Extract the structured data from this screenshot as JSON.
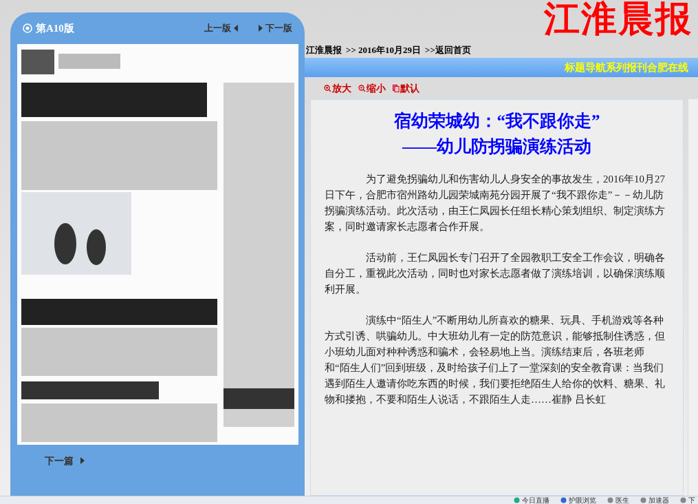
{
  "edition_panel": {
    "edition": "第A10版",
    "prev_label": "上一版",
    "next_label": "下一版",
    "next_article": "下一篇"
  },
  "header": {
    "logo": "江淮晨报",
    "breadcrumb": [
      {
        "text": "江淮晨报"
      },
      {
        "text": ">> 2016年10月29日"
      },
      {
        "text": ">>返回首页"
      }
    ],
    "nav_links": [
      "标题导航",
      "系列报刊",
      "合肥在线"
    ]
  },
  "zoom_controls": [
    {
      "kind": "zoom-in",
      "label": "放大"
    },
    {
      "kind": "zoom-out",
      "label": "缩小"
    },
    {
      "kind": "reset",
      "label": "默认"
    }
  ],
  "article": {
    "title_lines": [
      "宿幼荣城幼：“我不跟你走”",
      "——幼儿防拐骗演练活动"
    ],
    "paragraphs": [
      "为了避免拐骗幼儿和伤害幼儿人身安全的事故发生，2016年10月27日下午，合肥市宿州路幼儿园荣城南苑分园开展了“我不跟你走”－－幼儿防拐骗演练活动。此次活动，由王仁凤园长任组长精心策划组织、制定演练方案，同时邀请家长志愿者合作开展。",
      "活动前，王仁凤园长专门召开了全园教职工安全工作会议，明确各自分工，重视此次活动，同时也对家长志愿者做了演练培训，以确保演练顺利开展。",
      "演练中“陌生人”不断用幼儿所喜欢的糖果、玩具、手机游戏等各种方式引诱、哄骗幼儿。中大班幼儿有一定的防范意识，能够抵制住诱惑，但小班幼儿面对种种诱惑和骗术，会轻易地上当。演练结束后，各班老师和“陌生人们”回到班级，及时给孩子们上了一堂深刻的安全教育课：当我们遇到陌生人邀请你吃东西的时候，我们要拒绝陌生人给你的饮料、糖果、礼物和搂抱，不要和陌生人说话，不跟陌生人走……崔静 吕长虹"
    ]
  },
  "status_bar": [
    {
      "kind": "live",
      "label": "今日直播"
    },
    {
      "kind": "eye",
      "label": "护眼浏览"
    },
    {
      "kind": "doctor",
      "label": "医生"
    },
    {
      "kind": "boost",
      "label": "加速器"
    },
    {
      "kind": "download",
      "label": "下"
    }
  ]
}
